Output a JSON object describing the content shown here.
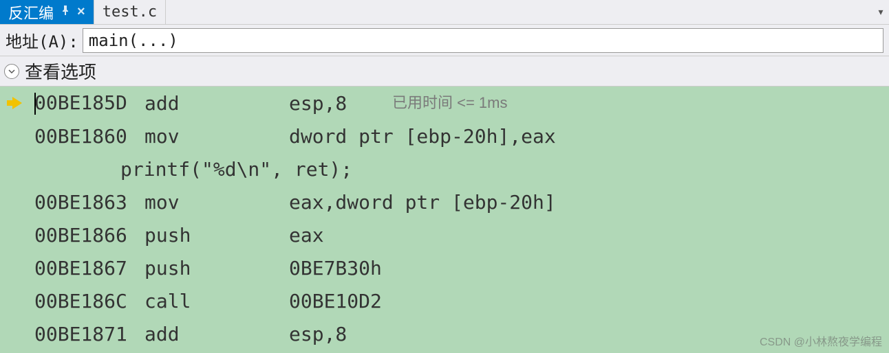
{
  "tabs": {
    "active": {
      "label": "反汇编"
    },
    "inactive": {
      "label": "test.c"
    }
  },
  "address": {
    "label": "地址(A):",
    "value": "main(...)"
  },
  "options": {
    "label": "查看选项"
  },
  "timing": "已用时间 <= 1ms",
  "code": {
    "lines": [
      {
        "type": "asm",
        "current": true,
        "addr": "00BE185D",
        "op": "add",
        "operand": "esp,8"
      },
      {
        "type": "asm",
        "current": false,
        "addr": "00BE1860",
        "op": "mov",
        "operand": "dword ptr [ebp-20h],eax"
      },
      {
        "type": "src",
        "text": "printf(\"%d\\n\", ret);"
      },
      {
        "type": "asm",
        "current": false,
        "addr": "00BE1863",
        "op": "mov",
        "operand": "eax,dword ptr [ebp-20h]"
      },
      {
        "type": "asm",
        "current": false,
        "addr": "00BE1866",
        "op": "push",
        "operand": "eax"
      },
      {
        "type": "asm",
        "current": false,
        "addr": "00BE1867",
        "op": "push",
        "operand": "0BE7B30h"
      },
      {
        "type": "asm",
        "current": false,
        "addr": "00BE186C",
        "op": "call",
        "operand": "00BE10D2"
      },
      {
        "type": "asm",
        "current": false,
        "addr": "00BE1871",
        "op": "add",
        "operand": "esp,8"
      }
    ]
  },
  "watermark": "CSDN @小林熬夜学编程"
}
